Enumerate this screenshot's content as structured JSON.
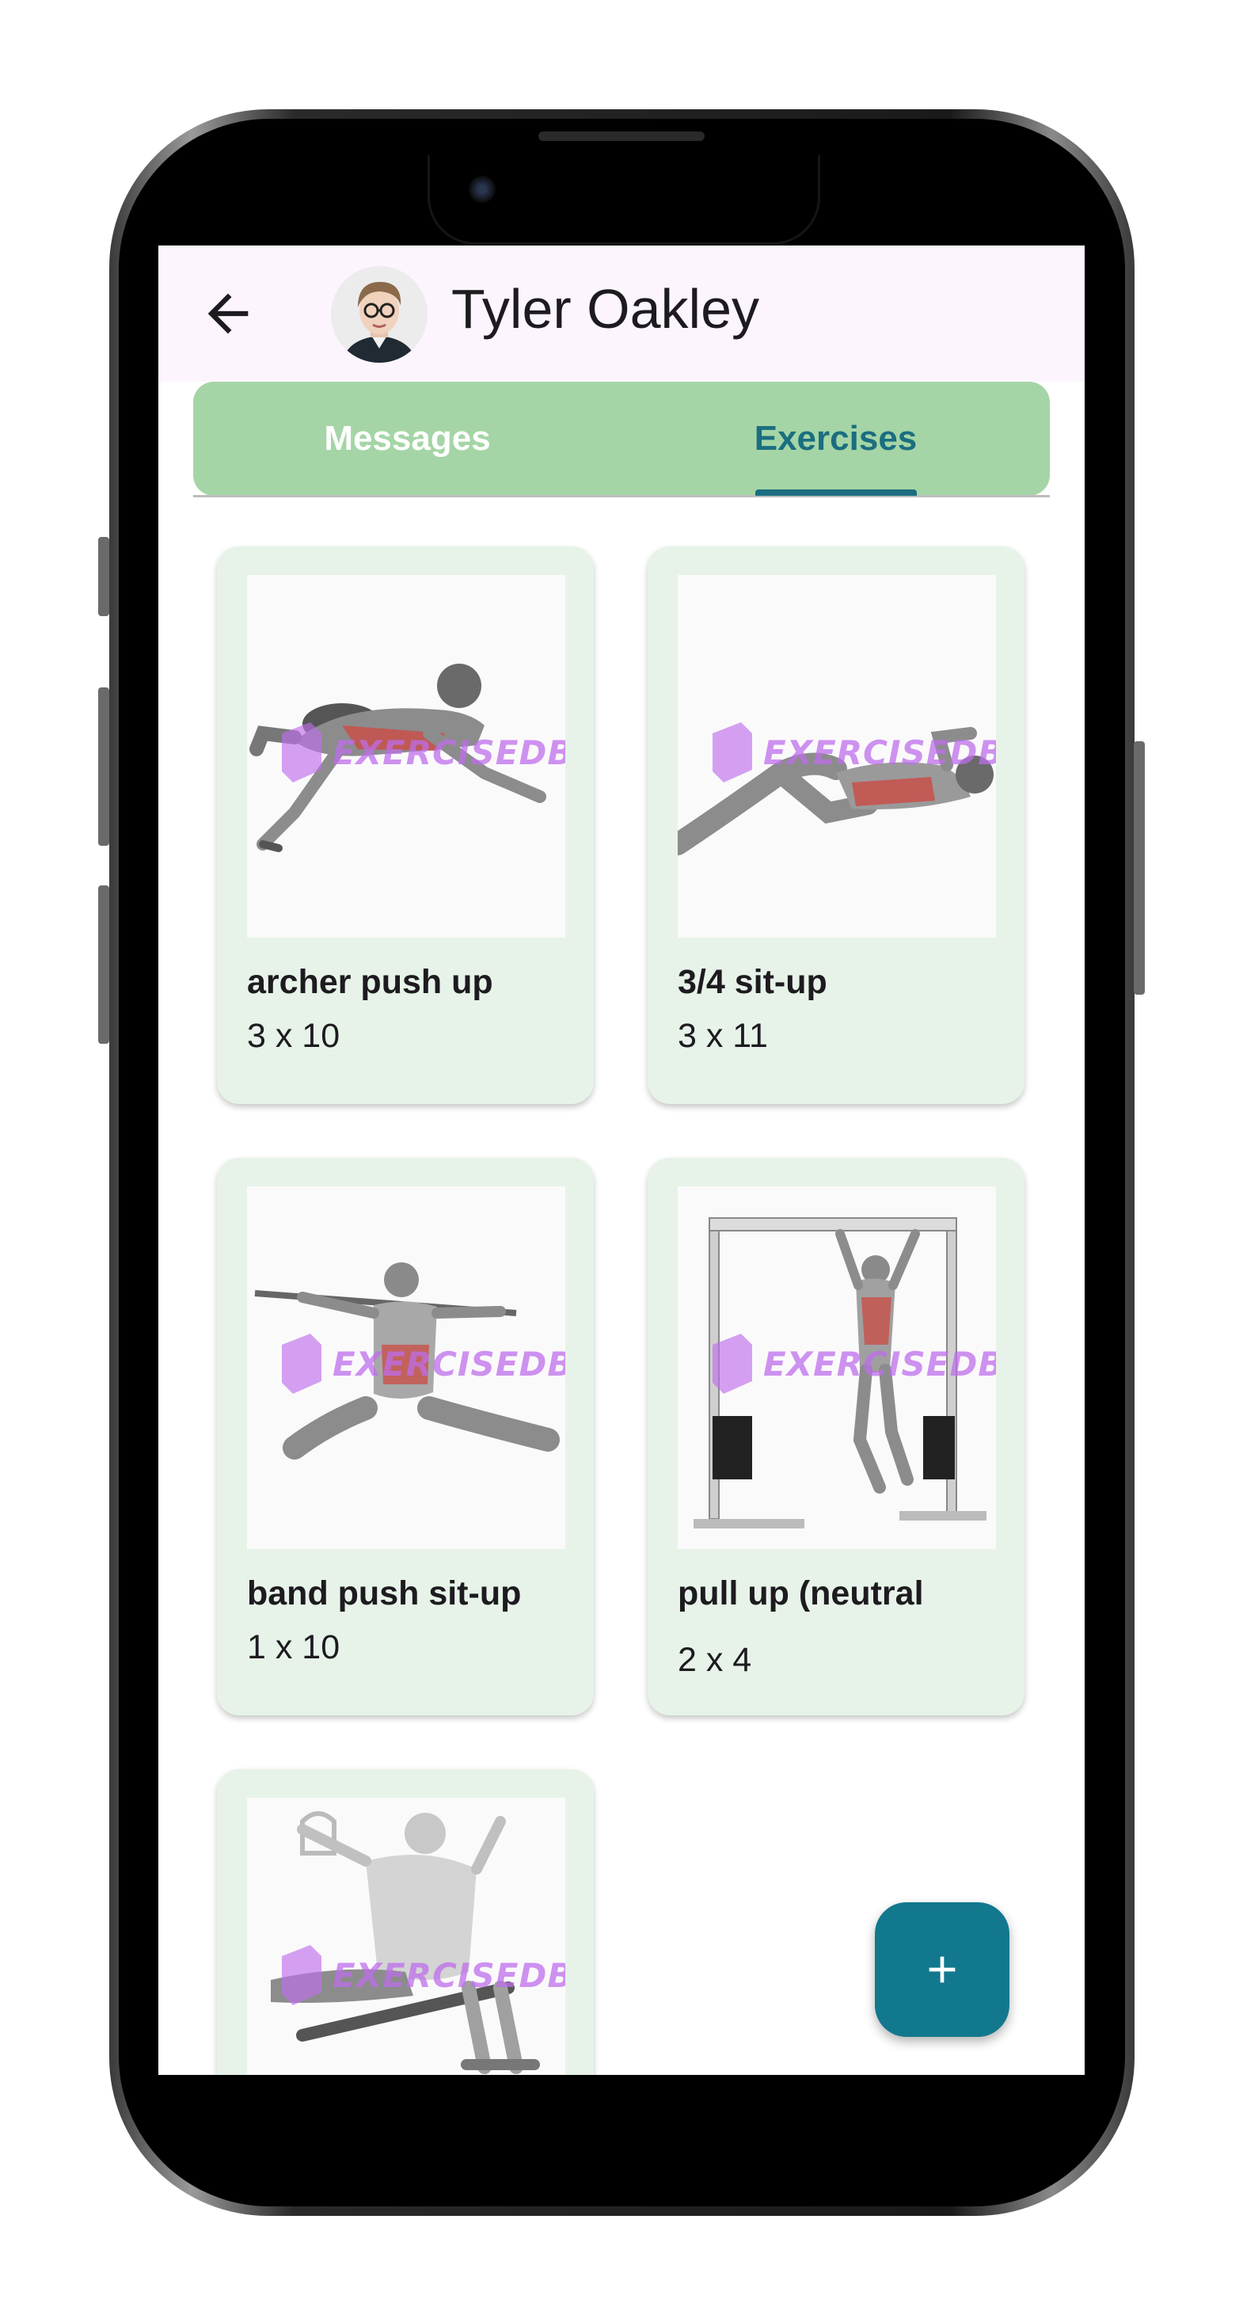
{
  "header": {
    "title": "Tyler Oakley",
    "back_icon": "arrow-back-icon",
    "avatar_icon": "avatar"
  },
  "tabs": [
    {
      "label": "Messages",
      "selected": false
    },
    {
      "label": "Exercises",
      "selected": true
    }
  ],
  "colors": {
    "appbar_bg": "#fdf5fd",
    "tabbar_bg": "#a5d5a6",
    "accent": "#1b6e80",
    "card_bg": "#e7f3e8",
    "fab_bg": "#12788e"
  },
  "exercises": [
    {
      "name": "archer push up",
      "reps": "3 x 10",
      "watermark": "EXERCISEDB"
    },
    {
      "name": "3/4 sit-up",
      "reps": "3 x 11",
      "watermark": "EXERCISEDB"
    },
    {
      "name": "band push sit-up",
      "reps": "1 x 10",
      "watermark": "EXERCISEDB"
    },
    {
      "name": "pull up (neutral",
      "reps": "2 x 4",
      "watermark": "EXERCISEDB"
    },
    {
      "name": "",
      "reps": "",
      "watermark": "EXERCISEDB"
    }
  ],
  "fab": {
    "icon": "plus-icon"
  }
}
